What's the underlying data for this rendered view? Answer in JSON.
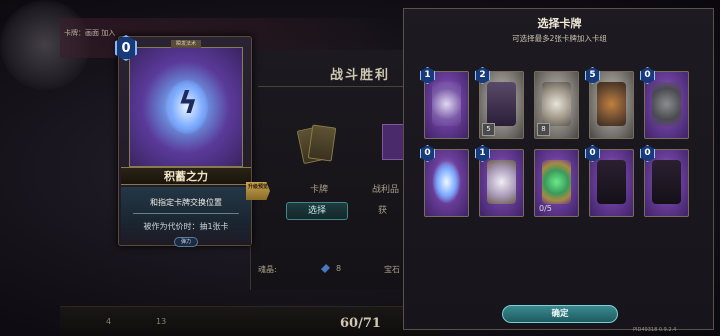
{
  "background": {
    "hint_text": "卡牌：画面 加入",
    "victory_title": "战斗胜利",
    "reward_card_label": "卡牌",
    "reward_select_button": "选择",
    "reward_2_label": "战利品",
    "reward_2_button": "获",
    "stats_label": "魂晶:",
    "stats_gem_value": "8",
    "stats_gem_label": "宝石",
    "bottom_left_1": "4",
    "bottom_left_2": "13",
    "progress": "60/71"
  },
  "preview_card": {
    "cost": "0",
    "type_tag": "瞬发法术",
    "name": "积蓄之力",
    "desc_line_1": "和指定卡牌交换位置",
    "desc_line_2": "被作为代价时：抽1张卡",
    "keyword": "弹力",
    "upgrade_badge": "升级预览",
    "icon": "lightning-orb-icon"
  },
  "select_panel": {
    "title": "选择卡牌",
    "subtitle": "可选择最多2张卡牌加入卡组",
    "confirm_label": "确定",
    "cards": [
      {
        "cost": "1",
        "count": "",
        "ratio": "",
        "style": "purple",
        "icon": "broken-shield-icon"
      },
      {
        "cost": "2",
        "count": "5",
        "ratio": "",
        "style": "gray",
        "icon": "cloaked-figure-icon"
      },
      {
        "cost": "",
        "count": "8",
        "ratio": "",
        "style": "gray",
        "icon": "armor-helm-icon"
      },
      {
        "cost": "5",
        "count": "",
        "ratio": "",
        "style": "gray",
        "icon": "mech-robot-icon"
      },
      {
        "cost": "0",
        "count": "",
        "ratio": "",
        "style": "purple",
        "icon": "gauntlet-icon"
      },
      {
        "cost": "0",
        "count": "",
        "ratio": "",
        "style": "purple",
        "icon": "lightning-orb-icon"
      },
      {
        "cost": "1",
        "count": "",
        "ratio": "",
        "style": "purple",
        "icon": "crystal-shield-icon"
      },
      {
        "cost": "",
        "count": "",
        "ratio": "0/5",
        "style": "purple",
        "icon": "crystal-ring-icon"
      },
      {
        "cost": "0",
        "count": "",
        "ratio": "",
        "style": "purple",
        "icon": "knight-silhouette-icon"
      },
      {
        "cost": "0",
        "count": "",
        "ratio": "",
        "style": "purple",
        "icon": "beast-silhouette-icon"
      }
    ]
  },
  "version": "PID49318 0.9.2.4"
}
